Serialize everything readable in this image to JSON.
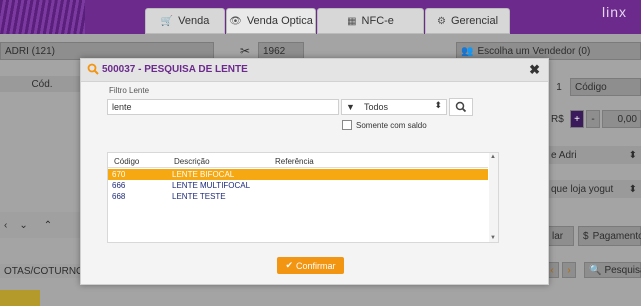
{
  "app": {
    "logo": "linx"
  },
  "tabs": [
    {
      "label": "Venda",
      "icon": "cart-icon"
    },
    {
      "label": "Venda Optica",
      "icon": "eye-icon"
    },
    {
      "label": "NFC-e",
      "icon": "grid-icon"
    },
    {
      "label": "Gerencial",
      "icon": "gears-icon"
    }
  ],
  "background": {
    "client": "ADRI (121)",
    "code_col": "Cód.",
    "number": "1962",
    "seller": "Escolha um Vendedor (0)",
    "qty": "1",
    "code_placeholder": "Código",
    "currency": "R$",
    "price": "0,00",
    "adri": "e Adri",
    "store": "que loja yogut",
    "cancel": "lar",
    "payment": "Pagamento",
    "notes_tab": "OTAS/COTURNO",
    "search_btn": "Pesquisa"
  },
  "modal": {
    "title": "500037 - PESQUISA DE LENTE",
    "filter_label": "Filtro Lente",
    "filter_value": "lente",
    "select_value": "Todos",
    "only_balance_label": "Somente com saldo",
    "columns": [
      "Código",
      "Descrição",
      "Referência"
    ],
    "rows": [
      {
        "code": "670",
        "desc": "LENTE BIFOCAL",
        "ref": ""
      },
      {
        "code": "666",
        "desc": "LENTE MULTIFOCAL",
        "ref": ""
      },
      {
        "code": "668",
        "desc": "LENTE TESTE",
        "ref": ""
      }
    ],
    "confirm_label": "Confirmar"
  }
}
